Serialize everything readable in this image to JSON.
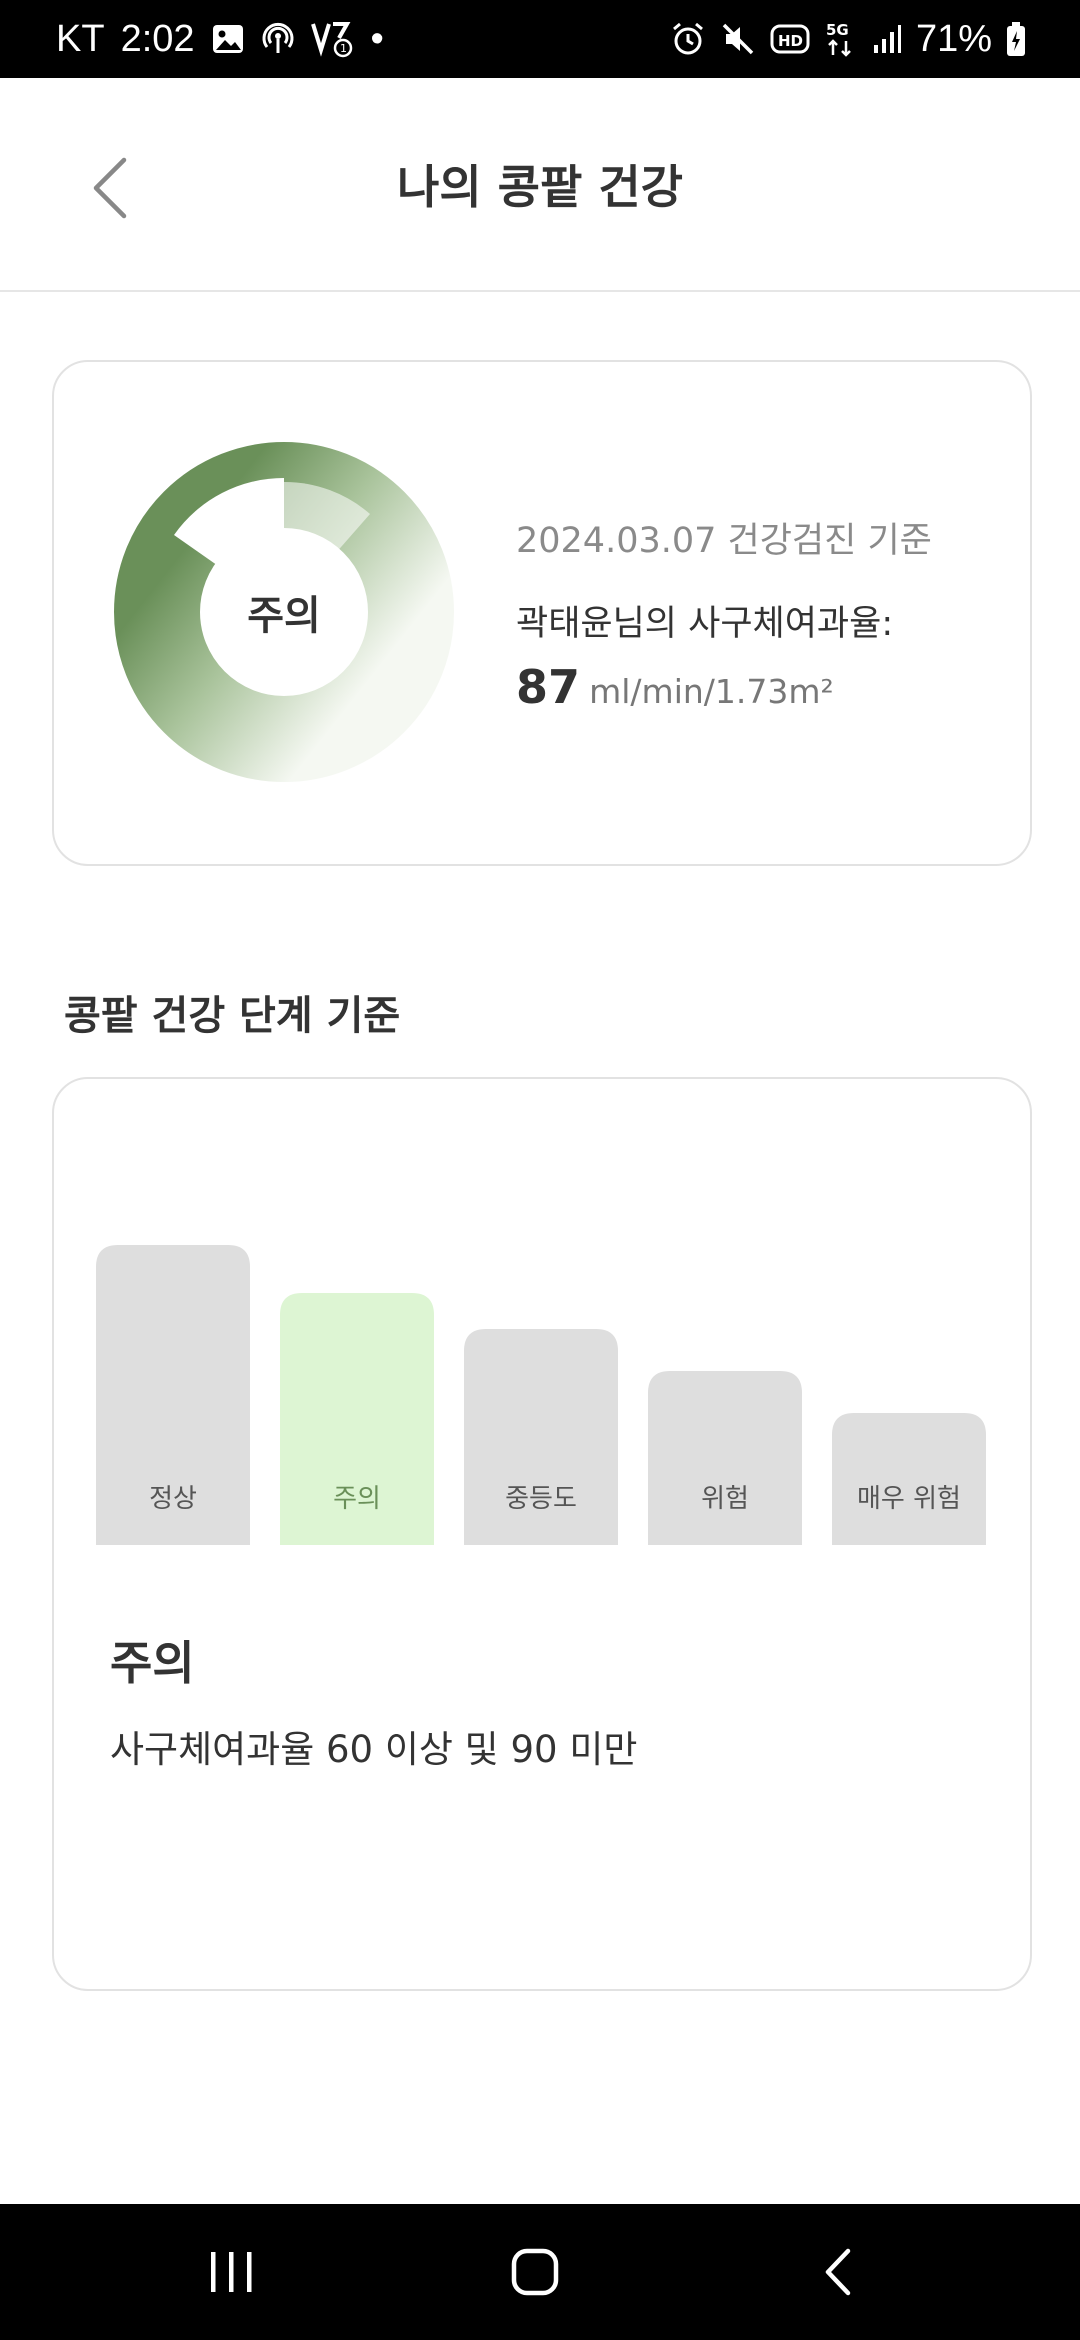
{
  "status_bar": {
    "carrier": "KT",
    "time": "2:02",
    "dot": "•",
    "battery": "71%",
    "network": "5G",
    "hd": "HD"
  },
  "header": {
    "title": "나의 콩팥 건강"
  },
  "summary": {
    "stage_label": "주의",
    "date_text": "2024.03.07 건강검진 기준",
    "gfr_label": "곽태윤님의 사구체여과율:",
    "gfr_value": "87",
    "gfr_unit": "ml/min/1.73m²",
    "accent_color": "#6a9059"
  },
  "criteria": {
    "section_title": "콩팥 건강 단계 기준",
    "selected_stage": "주의",
    "selected_description": "사구체여과율 60 이상 및 90 미만"
  },
  "chart_data": {
    "type": "bar",
    "categories": [
      "정상",
      "주의",
      "중등도",
      "위험",
      "매우 위험"
    ],
    "values": [
      5,
      4.2,
      3.6,
      2.9,
      2.2
    ],
    "highlight": "주의",
    "highlight_color": "#ddf5d3",
    "highlight_text_color": "#6a9059",
    "default_color": "#dedede",
    "title": "",
    "xlabel": "",
    "ylabel": ""
  }
}
